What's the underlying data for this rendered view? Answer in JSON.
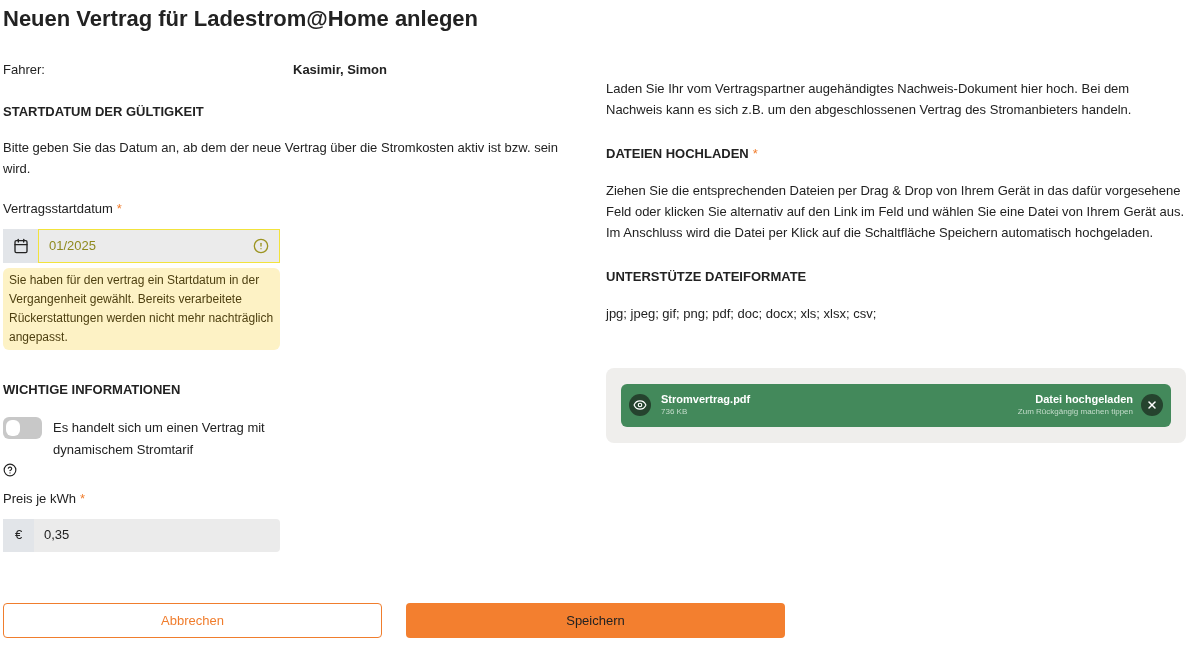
{
  "title": "Neuen Vertrag für Ladestrom@Home anlegen",
  "driver": {
    "label": "Fahrer:",
    "value": "Kasimir, Simon"
  },
  "start_section": {
    "heading": "STARTDATUM DER GÜLTIGKEIT",
    "text": "Bitte geben Sie das Datum an, ab dem der neue Vertrag über die Stromkosten aktiv ist bzw. sein wird.",
    "field": {
      "label": "Vertragsstartdatum",
      "required": "*",
      "value": "01/2025",
      "warning": true,
      "message": "Sie haben für den vertrag ein Startdatum in der Vergangenheit gewählt. Bereits verarbeitete Rückerstattungen werden nicht mehr nachträglich angepasst."
    }
  },
  "info_section": {
    "heading": "WICHTIGE INFORMATIONEN",
    "toggle": {
      "label": "Es handelt sich um einen Vertrag mit dynamischem Stromtarif",
      "on": false
    },
    "price": {
      "label": "Preis je kWh",
      "required": "*",
      "prefix": "€",
      "value": "0,35"
    }
  },
  "upload_intro": "Laden Sie Ihr vom Vertragspartner augehändigtes Nachweis-Dokument hier hoch. Bei dem Nachweis kann es sich z.B. um den abgeschlossenen Vertrag des Stromanbieters handeln.",
  "upload_section": {
    "heading": "DATEIEN HOCHLADEN",
    "required": "*",
    "text": "Ziehen Sie die entsprechenden Dateien per Drag & Drop von Ihrem Gerät in das dafür vorgesehene Feld oder klicken Sie alternativ auf den Link im Feld und wählen Sie eine Datei von Ihrem Gerät aus. Im Anschluss wird die Datei per Klick auf die Schaltfläche Speichern automatisch hochgeladen."
  },
  "formats_section": {
    "heading": "UNTERSTÜTZE DATEIFORMATE",
    "text": "jpg; jpeg; gif; png; pdf; doc; docx; xls; xlsx; csv;"
  },
  "files": [
    {
      "name": "Stromvertrag.pdf",
      "size": "736 KB",
      "status": "Datei hochgeladen",
      "hint": "Zum Rückgängig machen tippen"
    }
  ],
  "buttons": [
    {
      "label": "Abbrechen",
      "kind": "secondary"
    },
    {
      "label": "Speichern",
      "kind": "primary"
    }
  ]
}
